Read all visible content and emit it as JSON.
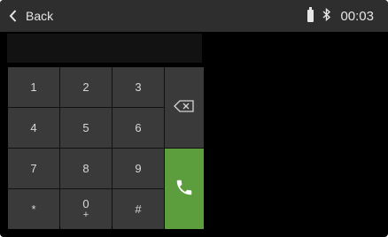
{
  "header": {
    "back_label": "Back",
    "time": "00:03"
  },
  "display": {
    "number": ""
  },
  "keypad": {
    "keys": [
      "1",
      "2",
      "3",
      "4",
      "5",
      "6",
      "7",
      "8",
      "9",
      "*",
      "0",
      "#"
    ],
    "zero_sub": "+"
  },
  "colors": {
    "call_button": "#5c9e3e",
    "key_background": "#3a3a3a",
    "status_bar": "#2e2e2e"
  },
  "icons": {
    "back": "chevron-left-icon",
    "battery": "battery-icon",
    "bluetooth": "bluetooth-icon",
    "backspace": "backspace-icon",
    "call": "phone-icon"
  }
}
